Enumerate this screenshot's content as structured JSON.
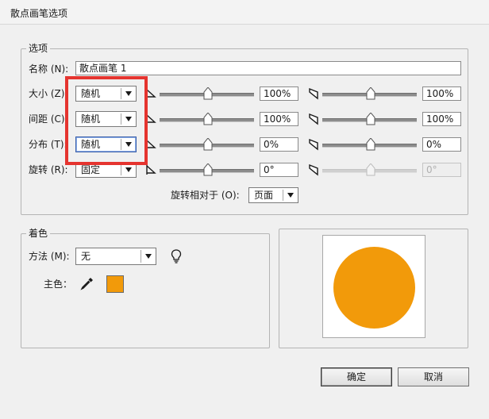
{
  "window": {
    "title": "散点画笔选项"
  },
  "options_group": {
    "label": "选项",
    "name": {
      "label": "名称 (N):",
      "value": "散点画笔 1"
    },
    "rows": [
      {
        "key": "size",
        "label": "大小 (Z):",
        "mode": "随机",
        "min_value": "100%",
        "max_value": "100%"
      },
      {
        "key": "spacing",
        "label": "间距 (C):",
        "mode": "随机",
        "min_value": "100%",
        "max_value": "100%"
      },
      {
        "key": "scatter",
        "label": "分布 (T):",
        "mode": "随机",
        "min_value": "0%",
        "max_value": "0%"
      },
      {
        "key": "rotation",
        "label": "旋转 (R):",
        "mode": "固定",
        "min_value": "0°",
        "max_value": "0°"
      }
    ],
    "rotation_relative": {
      "label": "旋转相对于 (O):",
      "value": "页面"
    }
  },
  "colorization_group": {
    "label": "着色",
    "method": {
      "label": "方法 (M):",
      "value": "无"
    },
    "key_color": {
      "label": "主色：",
      "color": "#f29a0a"
    }
  },
  "preview": {
    "shape_color": "#f29a0a"
  },
  "buttons": {
    "ok": "确定",
    "cancel": "取消"
  },
  "annotation": {
    "highlight_color": "#e5342f"
  }
}
